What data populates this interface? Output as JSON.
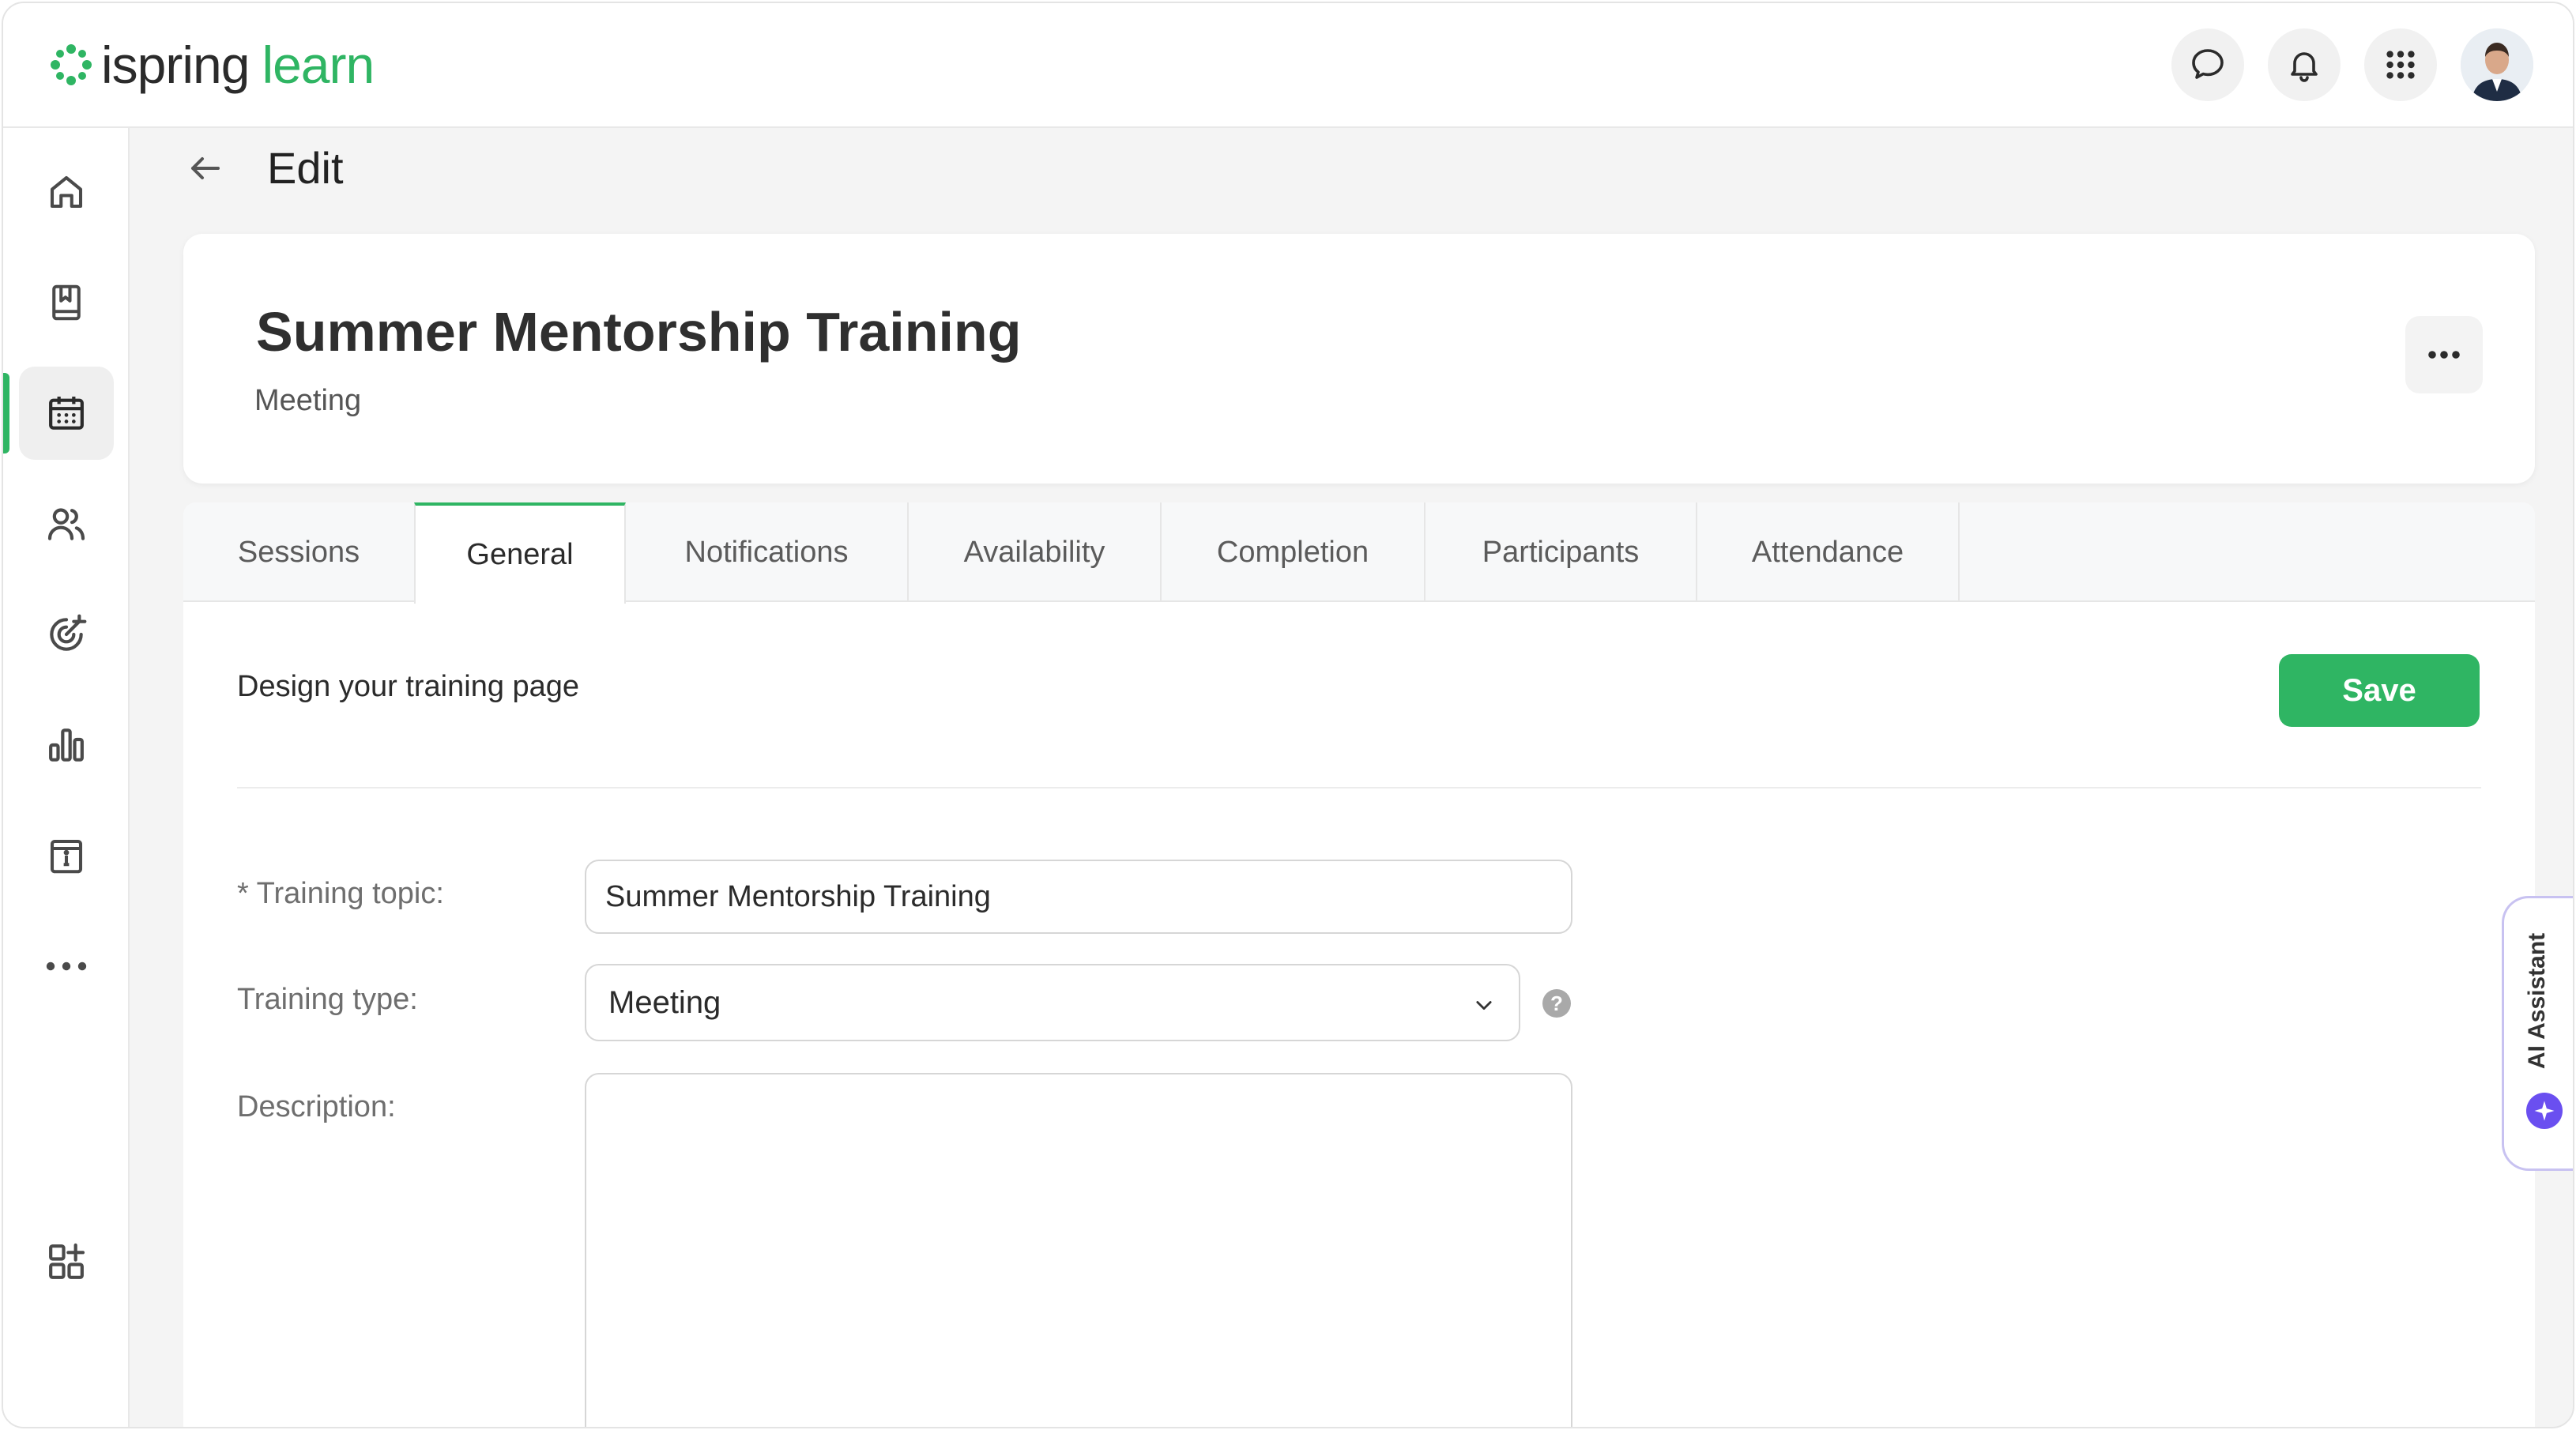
{
  "app": {
    "logo_word_1": "ispring",
    "logo_word_2": "learn",
    "brand_color": "#2fb563"
  },
  "header": {
    "icons": [
      "chat-icon",
      "bell-icon",
      "apps-grid-icon"
    ],
    "avatar": "user-avatar"
  },
  "sidebar": {
    "items": [
      {
        "icon": "home-icon",
        "active": false
      },
      {
        "icon": "book-icon",
        "active": false
      },
      {
        "icon": "calendar-icon",
        "active": true
      },
      {
        "icon": "users-icon",
        "active": false
      },
      {
        "icon": "target-icon",
        "active": false
      },
      {
        "icon": "bar-chart-icon",
        "active": false
      },
      {
        "icon": "info-panel-icon",
        "active": false
      },
      {
        "icon": "more-icon",
        "active": false
      },
      {
        "icon": "add-widget-icon",
        "active": false
      }
    ]
  },
  "page": {
    "title": "Edit"
  },
  "training_card": {
    "title": "Summer Mentorship Training",
    "type": "Meeting"
  },
  "tabs": [
    {
      "label": "Sessions",
      "active": false
    },
    {
      "label": "General",
      "active": true
    },
    {
      "label": "Notifications",
      "active": false
    },
    {
      "label": "Availability",
      "active": false
    },
    {
      "label": "Completion",
      "active": false
    },
    {
      "label": "Participants",
      "active": false
    },
    {
      "label": "Attendance",
      "active": false
    }
  ],
  "general": {
    "section_title": "Design your training page",
    "save_label": "Save",
    "topic_label": "* Training topic:",
    "topic_value": "Summer Mentorship Training",
    "type_label": "Training type:",
    "type_value": "Meeting",
    "description_label": "Description:",
    "description_value": ""
  },
  "ai_assistant": {
    "label": "AI Assistant",
    "accent": "#6a4ff0"
  }
}
